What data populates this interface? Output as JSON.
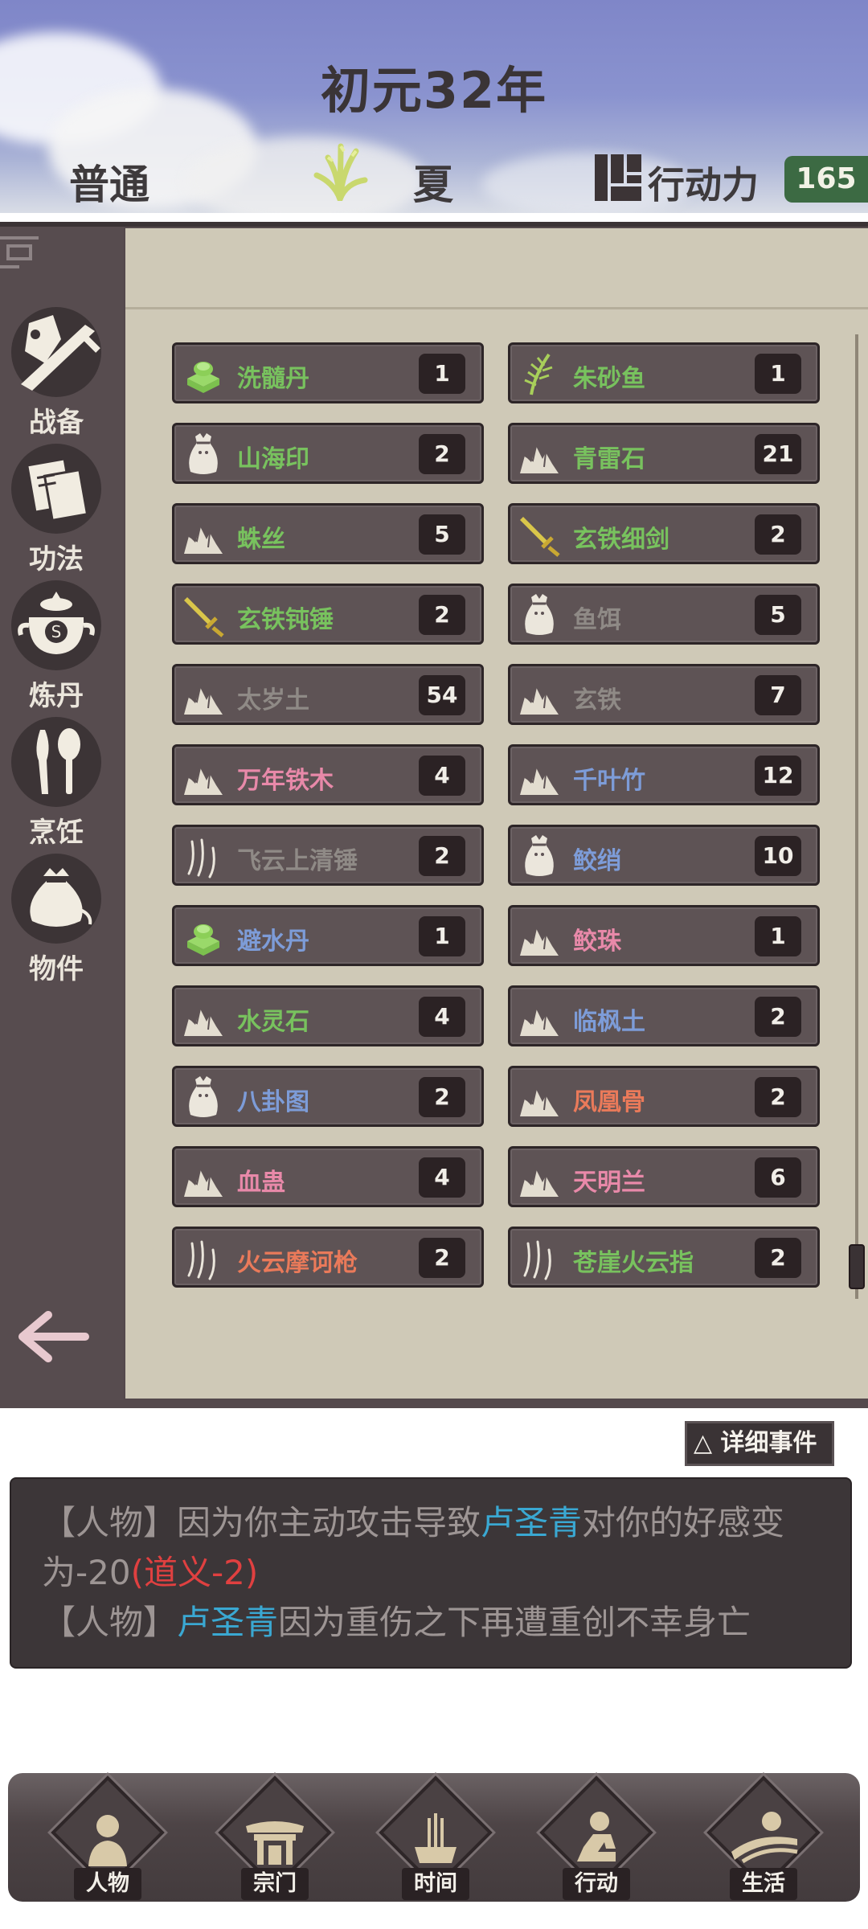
{
  "header": {
    "year": "初元32年",
    "difficulty": "普通",
    "season": "夏",
    "action_label": "行动力",
    "action_value": "165"
  },
  "sidebar": {
    "items": [
      {
        "label": "战备",
        "icon": "sword-shield-icon"
      },
      {
        "label": "功法",
        "icon": "scroll-book-icon"
      },
      {
        "label": "炼丹",
        "icon": "alchemy-pot-icon"
      },
      {
        "label": "烹饪",
        "icon": "knife-spoon-icon"
      },
      {
        "label": "物件",
        "icon": "pouch-icon"
      }
    ],
    "back_icon": "back-arrow-icon"
  },
  "inventory": {
    "items": [
      {
        "name": "洗髓丹",
        "count": "1",
        "icon": "pill-icon",
        "color": "#78c25e"
      },
      {
        "name": "朱砂鱼",
        "count": "1",
        "icon": "herb-icon",
        "color": "#78c25e"
      },
      {
        "name": "山海印",
        "count": "2",
        "icon": "pouch-icon",
        "color": "#78c25e"
      },
      {
        "name": "青雷石",
        "count": "21",
        "icon": "ore-icon",
        "color": "#78c25e"
      },
      {
        "name": "蛛丝",
        "count": "5",
        "icon": "ore-icon",
        "color": "#78c25e"
      },
      {
        "name": "玄铁细剑",
        "count": "2",
        "icon": "sword-icon",
        "color": "#78c25e"
      },
      {
        "name": "玄铁钝锤",
        "count": "2",
        "icon": "sword-icon",
        "color": "#78c25e"
      },
      {
        "name": "鱼饵",
        "count": "5",
        "icon": "pouch-icon",
        "color": "#8f8a86"
      },
      {
        "name": "太岁土",
        "count": "54",
        "icon": "ore-icon",
        "color": "#8f8a86"
      },
      {
        "name": "玄铁",
        "count": "7",
        "icon": "ore-icon",
        "color": "#8f8a86"
      },
      {
        "name": "万年铁木",
        "count": "4",
        "icon": "ore-icon",
        "color": "#e889a9"
      },
      {
        "name": "千叶竹",
        "count": "12",
        "icon": "ore-icon",
        "color": "#7d9cd8"
      },
      {
        "name": "飞云上清锤",
        "count": "2",
        "icon": "claw-mark-icon",
        "color": "#8f8a86"
      },
      {
        "name": "鲛绡",
        "count": "10",
        "icon": "pouch-icon",
        "color": "#7d9cd8"
      },
      {
        "name": "避水丹",
        "count": "1",
        "icon": "pill-icon",
        "color": "#7d9cd8"
      },
      {
        "name": "鲛珠",
        "count": "1",
        "icon": "ore-icon",
        "color": "#e889a9"
      },
      {
        "name": "水灵石",
        "count": "4",
        "icon": "ore-icon",
        "color": "#78c25e"
      },
      {
        "name": "临枫土",
        "count": "2",
        "icon": "ore-icon",
        "color": "#7d9cd8"
      },
      {
        "name": "八卦图",
        "count": "2",
        "icon": "pouch-icon",
        "color": "#7d9cd8"
      },
      {
        "name": "凤凰骨",
        "count": "2",
        "icon": "ore-icon",
        "color": "#ea7a5a"
      },
      {
        "name": "血蛊",
        "count": "4",
        "icon": "ore-icon",
        "color": "#e889a9"
      },
      {
        "name": "天明兰",
        "count": "6",
        "icon": "ore-icon",
        "color": "#e889a9"
      },
      {
        "name": "火云摩诃枪",
        "count": "2",
        "icon": "claw-mark-icon",
        "color": "#ea7a5a"
      },
      {
        "name": "苍崖火云指",
        "count": "2",
        "icon": "claw-mark-icon",
        "color": "#78c25e"
      }
    ]
  },
  "detail_button": "△ 详细事件",
  "log": {
    "line1_tag": "【人物】",
    "line1_pre": "因为你主动攻击导致",
    "line1_name": "卢圣青",
    "line1_post": "对你的好感变",
    "line2_pre": "为-20",
    "line2_red": "(道义-2)",
    "line3_tag": "【人物】",
    "line3_name": "卢圣青",
    "line3_post": "因为重伤之下再遭重创不幸身亡",
    "name_color": "#3aa8d2",
    "warn_color": "#e04040"
  },
  "bottom_nav": [
    {
      "label": "人物",
      "icon": "person-icon"
    },
    {
      "label": "宗门",
      "icon": "gate-icon"
    },
    {
      "label": "时间",
      "icon": "incense-icon"
    },
    {
      "label": "行动",
      "icon": "action-icon"
    },
    {
      "label": "生活",
      "icon": "field-icon"
    }
  ]
}
